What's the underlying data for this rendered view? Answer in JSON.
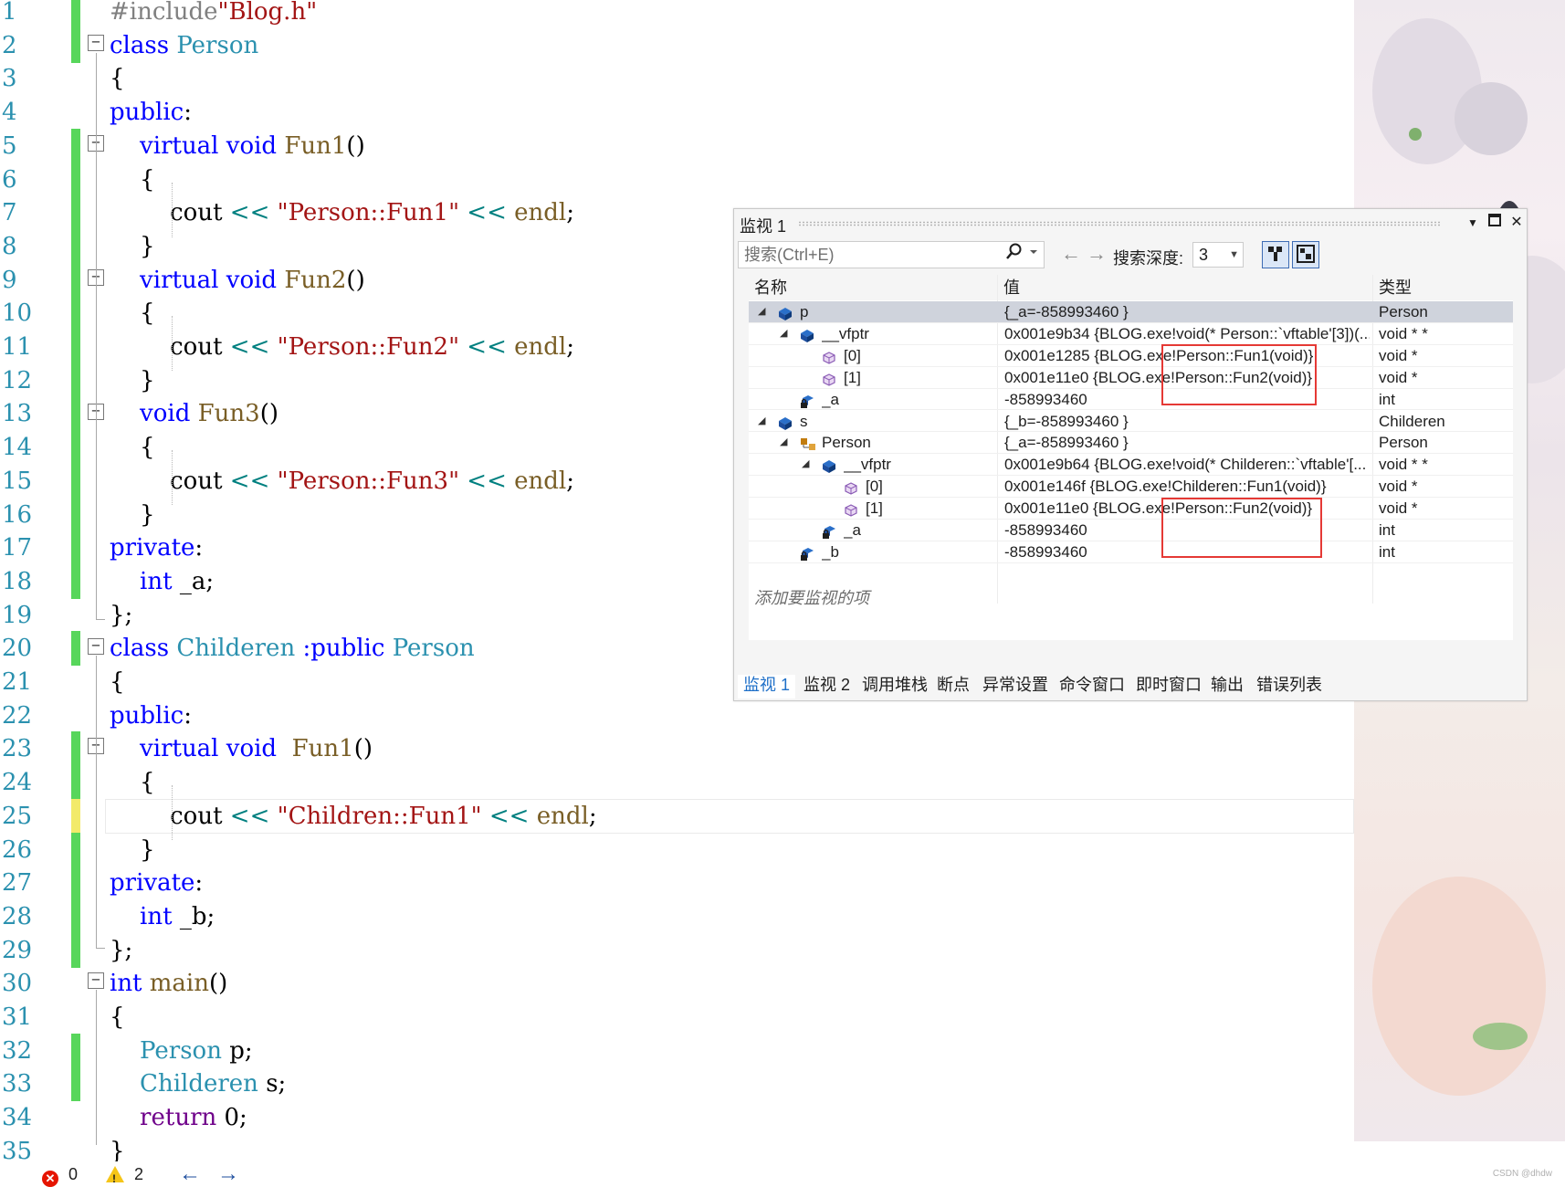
{
  "editor": {
    "lines": [
      {
        "n": "1",
        "tokens": [
          {
            "t": "#include",
            "c": "t-pre"
          },
          {
            "t": "\"Blog.h\"",
            "c": "t-str"
          }
        ]
      },
      {
        "n": "2",
        "tokens": [
          {
            "t": "class ",
            "c": "t-kw"
          },
          {
            "t": "Person",
            "c": "t-id"
          }
        ]
      },
      {
        "n": "3",
        "tokens": [
          {
            "t": "{",
            "c": ""
          }
        ]
      },
      {
        "n": "4",
        "tokens": [
          {
            "t": "public",
            "c": "t-kw"
          },
          {
            "t": ":",
            "c": ""
          }
        ]
      },
      {
        "n": "5",
        "tokens": [
          {
            "t": "    virtual ",
            "c": "t-kw"
          },
          {
            "t": "void ",
            "c": "t-kw"
          },
          {
            "t": "Fun1",
            "c": "t-fn"
          },
          {
            "t": "()",
            "c": ""
          }
        ]
      },
      {
        "n": "6",
        "tokens": [
          {
            "t": "    {",
            "c": ""
          }
        ]
      },
      {
        "n": "7",
        "tokens": [
          {
            "t": "        cout ",
            "c": ""
          },
          {
            "t": "<< ",
            "c": "t-op"
          },
          {
            "t": "\"Person::Fun1\"",
            "c": "t-str"
          },
          {
            "t": " << ",
            "c": "t-op"
          },
          {
            "t": "endl",
            "c": "t-fn"
          },
          {
            "t": ";",
            "c": ""
          }
        ]
      },
      {
        "n": "8",
        "tokens": [
          {
            "t": "    }",
            "c": ""
          }
        ]
      },
      {
        "n": "9",
        "tokens": [
          {
            "t": "    virtual ",
            "c": "t-kw"
          },
          {
            "t": "void ",
            "c": "t-kw"
          },
          {
            "t": "Fun2",
            "c": "t-fn"
          },
          {
            "t": "()",
            "c": ""
          }
        ]
      },
      {
        "n": "10",
        "tokens": [
          {
            "t": "    {",
            "c": ""
          }
        ]
      },
      {
        "n": "11",
        "tokens": [
          {
            "t": "        cout ",
            "c": ""
          },
          {
            "t": "<< ",
            "c": "t-op"
          },
          {
            "t": "\"Person::Fun2\"",
            "c": "t-str"
          },
          {
            "t": " << ",
            "c": "t-op"
          },
          {
            "t": "endl",
            "c": "t-fn"
          },
          {
            "t": ";",
            "c": ""
          }
        ]
      },
      {
        "n": "12",
        "tokens": [
          {
            "t": "    }",
            "c": ""
          }
        ]
      },
      {
        "n": "13",
        "tokens": [
          {
            "t": "    void ",
            "c": "t-kw"
          },
          {
            "t": "Fun3",
            "c": "t-fn"
          },
          {
            "t": "()",
            "c": ""
          }
        ]
      },
      {
        "n": "14",
        "tokens": [
          {
            "t": "    {",
            "c": ""
          }
        ]
      },
      {
        "n": "15",
        "tokens": [
          {
            "t": "        cout ",
            "c": ""
          },
          {
            "t": "<< ",
            "c": "t-op"
          },
          {
            "t": "\"Person::Fun3\"",
            "c": "t-str"
          },
          {
            "t": " << ",
            "c": "t-op"
          },
          {
            "t": "endl",
            "c": "t-fn"
          },
          {
            "t": ";",
            "c": ""
          }
        ]
      },
      {
        "n": "16",
        "tokens": [
          {
            "t": "    }",
            "c": ""
          }
        ]
      },
      {
        "n": "17",
        "tokens": [
          {
            "t": "private",
            "c": "t-kw"
          },
          {
            "t": ":",
            "c": ""
          }
        ]
      },
      {
        "n": "18",
        "tokens": [
          {
            "t": "    int ",
            "c": "t-kw"
          },
          {
            "t": "_a;",
            "c": ""
          }
        ]
      },
      {
        "n": "19",
        "tokens": [
          {
            "t": "};",
            "c": ""
          }
        ]
      },
      {
        "n": "20",
        "tokens": [
          {
            "t": "class ",
            "c": "t-kw"
          },
          {
            "t": "Childeren ",
            "c": "t-id"
          },
          {
            "t": ":public ",
            "c": "t-kw"
          },
          {
            "t": "Person",
            "c": "t-id"
          }
        ]
      },
      {
        "n": "21",
        "tokens": [
          {
            "t": "{",
            "c": ""
          }
        ]
      },
      {
        "n": "22",
        "tokens": [
          {
            "t": "public",
            "c": "t-kw"
          },
          {
            "t": ":",
            "c": ""
          }
        ]
      },
      {
        "n": "23",
        "tokens": [
          {
            "t": "    virtual ",
            "c": "t-kw"
          },
          {
            "t": "void  ",
            "c": "t-kw"
          },
          {
            "t": "Fun1",
            "c": "t-fn"
          },
          {
            "t": "()",
            "c": ""
          }
        ]
      },
      {
        "n": "24",
        "tokens": [
          {
            "t": "    {",
            "c": ""
          }
        ]
      },
      {
        "n": "25",
        "tokens": [
          {
            "t": "        cout ",
            "c": ""
          },
          {
            "t": "<< ",
            "c": "t-op"
          },
          {
            "t": "\"Children::Fun1\"",
            "c": "t-str"
          },
          {
            "t": " << ",
            "c": "t-op"
          },
          {
            "t": "endl",
            "c": "t-fn"
          },
          {
            "t": ";",
            "c": ""
          }
        ]
      },
      {
        "n": "26",
        "tokens": [
          {
            "t": "    }",
            "c": ""
          }
        ]
      },
      {
        "n": "27",
        "tokens": [
          {
            "t": "private",
            "c": "t-kw"
          },
          {
            "t": ":",
            "c": ""
          }
        ]
      },
      {
        "n": "28",
        "tokens": [
          {
            "t": "    int ",
            "c": "t-kw"
          },
          {
            "t": "_b;",
            "c": ""
          }
        ]
      },
      {
        "n": "29",
        "tokens": [
          {
            "t": "};",
            "c": ""
          }
        ]
      },
      {
        "n": "30",
        "tokens": [
          {
            "t": "int ",
            "c": "t-kw"
          },
          {
            "t": "main",
            "c": "t-fn"
          },
          {
            "t": "()",
            "c": ""
          }
        ]
      },
      {
        "n": "31",
        "tokens": [
          {
            "t": "{",
            "c": ""
          }
        ]
      },
      {
        "n": "32",
        "tokens": [
          {
            "t": "    Person ",
            "c": "t-id"
          },
          {
            "t": "p;",
            "c": ""
          }
        ]
      },
      {
        "n": "33",
        "tokens": [
          {
            "t": "    Childeren ",
            "c": "t-id"
          },
          {
            "t": "s;",
            "c": ""
          }
        ]
      },
      {
        "n": "34",
        "tokens": [
          {
            "t": "    return ",
            "c": "t-mac"
          },
          {
            "t": "0;",
            "c": ""
          }
        ]
      },
      {
        "n": "35",
        "tokens": [
          {
            "t": "}",
            "c": ""
          }
        ]
      }
    ]
  },
  "watch": {
    "title": "监视 1",
    "search_placeholder": "搜索(Ctrl+E)",
    "depth_label": "搜索深度:",
    "depth_value": "3",
    "columns": {
      "name": "名称",
      "value": "值",
      "type": "类型"
    },
    "rows": [
      {
        "name": "p",
        "value": "{_a=-858993460 }",
        "type": "Person"
      },
      {
        "name": "__vfptr",
        "value": "0x001e9b34 {BLOG.exe!void(* Person::`vftable'[3])(...",
        "type": "void * *"
      },
      {
        "name": "[0]",
        "value": "0x001e1285 {BLOG.exe!Person::Fun1(void)}",
        "type": "void *"
      },
      {
        "name": "[1]",
        "value": "0x001e11e0 {BLOG.exe!Person::Fun2(void)}",
        "type": "void *"
      },
      {
        "name": "_a",
        "value": "-858993460",
        "type": "int"
      },
      {
        "name": "s",
        "value": "{_b=-858993460 }",
        "type": "Childeren"
      },
      {
        "name": "Person",
        "value": "{_a=-858993460 }",
        "type": "Person"
      },
      {
        "name": "__vfptr",
        "value": "0x001e9b64 {BLOG.exe!void(* Childeren::`vftable'[...",
        "type": "void * *"
      },
      {
        "name": "[0]",
        "value": "0x001e146f {BLOG.exe!Childeren::Fun1(void)}",
        "type": "void *"
      },
      {
        "name": "[1]",
        "value": "0x001e11e0 {BLOG.exe!Person::Fun2(void)}",
        "type": "void *"
      },
      {
        "name": "_a",
        "value": "-858993460",
        "type": "int"
      },
      {
        "name": "_b",
        "value": "-858993460",
        "type": "int"
      }
    ],
    "add_watch": "添加要监视的项",
    "tabs": [
      "监视 1",
      "监视 2",
      "调用堆栈",
      "断点",
      "异常设置",
      "命令窗口",
      "即时窗口",
      "输出",
      "错误列表"
    ]
  },
  "status": {
    "errors": "0",
    "warnings": "2",
    "watermark": "CSDN @dhdw"
  }
}
